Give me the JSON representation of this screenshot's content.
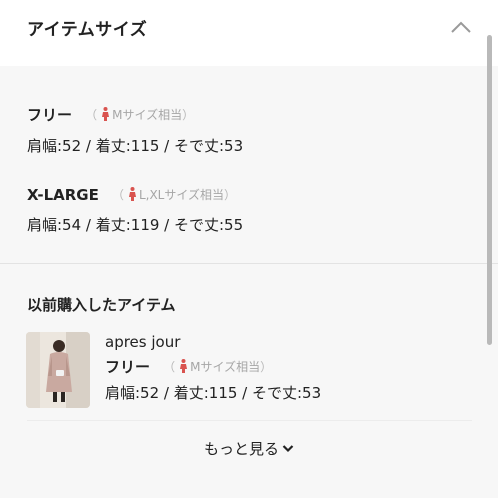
{
  "header": {
    "title": "アイテムサイズ",
    "collapse_icon": "chevron-up-icon"
  },
  "sizes": [
    {
      "name": "フリー",
      "hint_open": "（",
      "hint_text": "Mサイズ相当",
      "hint_close": "）",
      "measurements": "肩幅:52 / 着丈:115 / そで丈:53"
    },
    {
      "name": "X-LARGE",
      "hint_open": "（",
      "hint_text": "L,XLサイズ相当",
      "hint_close": "）",
      "measurements": "肩幅:54 / 着丈:119 / そで丈:55"
    }
  ],
  "purchased": {
    "title": "以前購入したアイテム",
    "items": [
      {
        "brand": "apres jour",
        "size_name": "フリー",
        "hint_open": "（",
        "hint_text": "Mサイズ相当",
        "hint_close": "）",
        "measurements": "肩幅:52 / 着丈:115 / そで丈:53"
      }
    ]
  },
  "more_label": "もっと見る",
  "colors": {
    "person_icon": "#d9534f",
    "hint_text": "#a6a6a6",
    "background": "#f7f7f7"
  }
}
